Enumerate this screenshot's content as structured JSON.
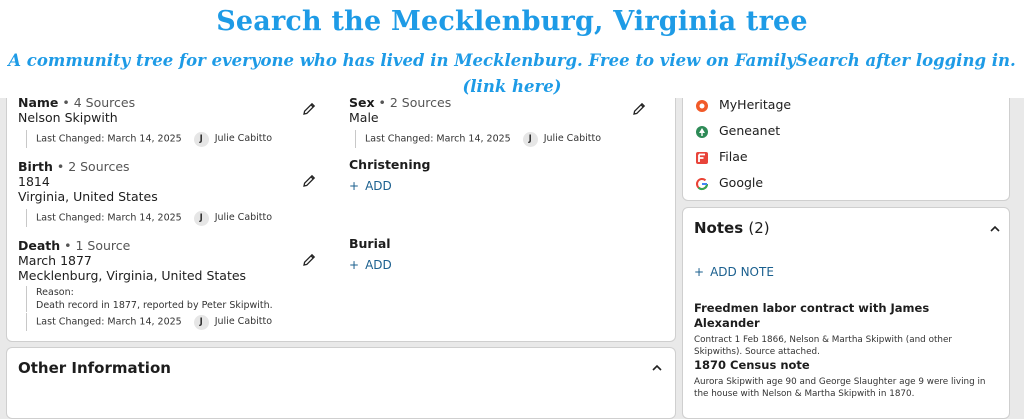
{
  "banner": {
    "title": "Search the Mecklenburg, Virginia tree",
    "subtitle": "A community tree for everyone who has lived in Mecklenburg. Free to view on FamilySearch after logging in.",
    "link": "(link here)",
    "color": "#1e9be6"
  },
  "vitals": {
    "name": {
      "label": "Name",
      "sources": "• 4 Sources",
      "value": "Nelson Skipwith",
      "changed": "Last Changed: March 14, 2025",
      "initial": "J",
      "user": "Julie Cabitto"
    },
    "sex": {
      "label": "Sex",
      "sources": "• 2 Sources",
      "value": "Male",
      "changed": "Last Changed: March 14, 2025",
      "initial": "J",
      "user": "Julie Cabitto"
    },
    "birth": {
      "label": "Birth",
      "sources": "• 2 Sources",
      "date": "1814",
      "place": "Virginia, United States",
      "changed": "Last Changed: March 14, 2025",
      "initial": "J",
      "user": "Julie Cabitto"
    },
    "christening": {
      "label": "Christening",
      "add": "ADD"
    },
    "death": {
      "label": "Death",
      "sources": "• 1 Source",
      "date": "March 1877",
      "place": "Mecklenburg, Virginia, United States",
      "reason_label": "Reason:",
      "reason": "Death record in 1877, reported by Peter Skipwith.",
      "changed": "Last Changed: March 14, 2025",
      "initial": "J",
      "user": "Julie Cabitto"
    },
    "burial": {
      "label": "Burial",
      "add": "ADD"
    }
  },
  "other": {
    "title": "Other Information"
  },
  "links": {
    "items": [
      {
        "label": "MyHeritage",
        "icon": "myheritage-icon",
        "color": "#f15a29"
      },
      {
        "label": "Geneanet",
        "icon": "geneanet-icon",
        "color": "#2e8b57"
      },
      {
        "label": "Filae",
        "icon": "filae-icon",
        "color": "#e8443a"
      },
      {
        "label": "Google",
        "icon": "google-icon",
        "color": "#4285f4"
      }
    ]
  },
  "notes": {
    "title": "Notes",
    "count": "(2)",
    "add": "ADD NOTE",
    "items": [
      {
        "title": "Freedmen labor contract with James Alexander",
        "text": "Contract 1 Feb 1866, Nelson & Martha Skipwith (and other Skipwiths). Source attached."
      },
      {
        "title": "1870 Census note",
        "text": "Aurora Skipwith age 90 and George Slaughter age 9 were living in the house with Nelson & Martha Skipwith in 1870."
      }
    ]
  }
}
